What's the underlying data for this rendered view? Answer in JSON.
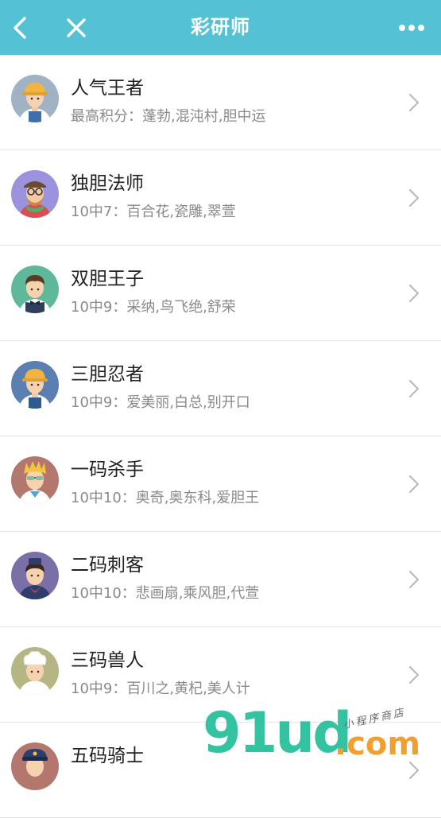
{
  "header": {
    "title": "彩研师",
    "icons": {
      "back": "back-icon",
      "close": "close-icon",
      "more": "more-icon"
    },
    "color": "#54c1d4"
  },
  "list": [
    {
      "name": "人气王者",
      "subtitle": "最高积分：蓬勃,混沌村,胆中运",
      "avatar": "worker-hardhat-avatar"
    },
    {
      "name": "独胆法师",
      "subtitle": "10中7：百合花,瓷雕,翠萱",
      "avatar": "hipster-glasses-avatar"
    },
    {
      "name": "双胆王子",
      "subtitle": "10中9：采纳,鸟飞绝,舒荣",
      "avatar": "waiter-bowtie-avatar"
    },
    {
      "name": "三胆忍者",
      "subtitle": "10中9：爱美丽,白总,别开口",
      "avatar": "worker-hardhat-avatar"
    },
    {
      "name": "一码杀手",
      "subtitle": "10中10：奥奇,奥东科,爱胆王",
      "avatar": "blonde-sunglasses-avatar"
    },
    {
      "name": "二码刺客",
      "subtitle": "10中10：悲画扇,乘风胆,代萱",
      "avatar": "flight-attendant-avatar"
    },
    {
      "name": "三码兽人",
      "subtitle": "10中9：百川之,黄杞,美人计",
      "avatar": "chef-avatar"
    },
    {
      "name": "五码骑士",
      "subtitle": "",
      "avatar": "police-avatar"
    }
  ],
  "watermark": {
    "main": "91ud",
    "domain": ".com",
    "tagline": "小程序商店"
  }
}
